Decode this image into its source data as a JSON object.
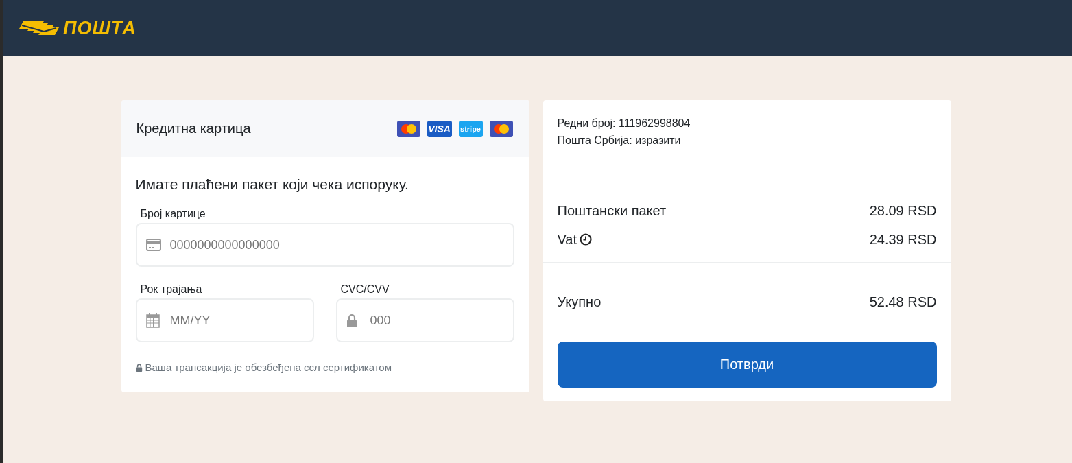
{
  "header": {
    "logo_text": "ПОШТА"
  },
  "payment": {
    "title": "Кредитна картица",
    "card_brands": [
      {
        "kind": "mastercard"
      },
      {
        "kind": "visa",
        "label": "VISA"
      },
      {
        "kind": "stripe",
        "label": "stripe"
      },
      {
        "kind": "mastercard"
      }
    ],
    "message": "Имате плаћени пакет који чека испоруку.",
    "fields": [
      {
        "kind": "card",
        "label": "Број картице",
        "placeholder": "0000000000000000"
      },
      {
        "kind": "expiry",
        "label": "Рок трајања",
        "placeholder": "MM/YY"
      },
      {
        "kind": "cvc",
        "label": "CVC/CVV",
        "placeholder": "000"
      }
    ],
    "security_note": "Ваша трансакција је обезбеђена ссл сертификатом"
  },
  "summary": {
    "info": [
      "Редни број: 111962998804",
      "Пошта Србија: изразити"
    ],
    "items": [
      {
        "label": "Поштански пакет",
        "amount": "28.09 RSD",
        "kind": "plain"
      },
      {
        "label": "Vat",
        "amount": "24.39 RSD",
        "kind": "clock"
      }
    ],
    "total": {
      "label": "Укупно",
      "amount": "52.48 RSD"
    },
    "confirm_button": "Потврди"
  }
}
